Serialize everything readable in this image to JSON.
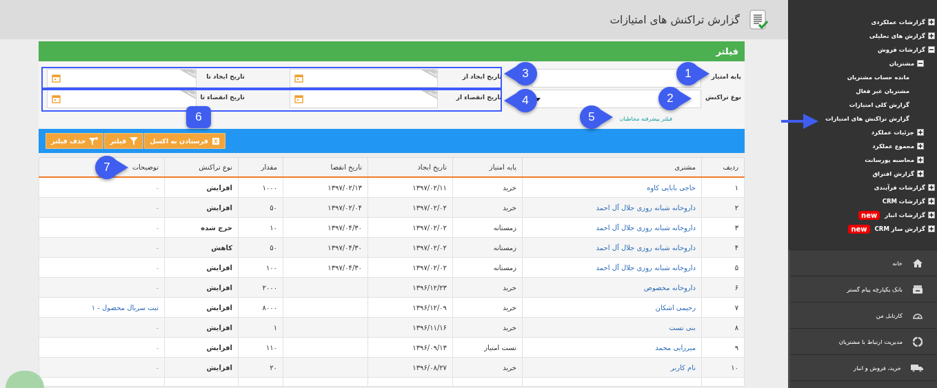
{
  "header": {
    "title": "گزارش تراکنش های امتیازات"
  },
  "filter": {
    "title": "فیلتر",
    "rows": [
      {
        "fields": [
          {
            "kind": "text",
            "label": "پایه امتیاز"
          },
          {
            "kind": "date",
            "label": "تاریخ ایجاد از"
          },
          {
            "kind": "date",
            "label": "تاریخ ایجاد تا"
          }
        ]
      },
      {
        "fields": [
          {
            "kind": "select",
            "label": "نوع تراکنش"
          },
          {
            "kind": "date",
            "label": "تاریخ انقضاء از"
          },
          {
            "kind": "date",
            "label": "تاریخ انقضاء تا"
          }
        ]
      }
    ],
    "advanced_link": "فیلتر پیشرفته مخاطبان",
    "toolbar": [
      {
        "label": "فرستادن به اکسل",
        "kind": "export"
      },
      {
        "label": "فیلتر",
        "kind": "filter"
      },
      {
        "label": "حذف فیلتر",
        "kind": "clear"
      }
    ]
  },
  "table": {
    "columns": [
      "ردیف",
      "مشتری",
      "پایه امتیاز",
      "تاریخ ایجاد",
      "تاریخ انقضا",
      "مقدار",
      "نوع تراکنش",
      "توضیحات"
    ],
    "rows": [
      {
        "index": "۱",
        "customer": "حاجی بابایی کاوه",
        "basis": "خرید",
        "created": "۱۳۹۷/۰۲/۱۱",
        "expires": "۱۳۹۷/۰۲/۱۳",
        "amount": "۱۰۰۰",
        "type": "افزایش",
        "note": "-",
        "note_is_link": false
      },
      {
        "index": "۲",
        "customer": "داروخانه شبانه روزی جلال آل احمد",
        "basis": "خرید",
        "created": "۱۳۹۷/۰۲/۰۲",
        "expires": "۱۳۹۷/۰۲/۰۴",
        "amount": "۵۰",
        "type": "افزایش",
        "note": "-",
        "note_is_link": false
      },
      {
        "index": "۳",
        "customer": "داروخانه شبانه روزی جلال آل احمد",
        "basis": "زمستانه",
        "created": "۱۳۹۷/۰۲/۰۲",
        "expires": "۱۳۹۷/۰۴/۳۰",
        "amount": "۱۰",
        "type": "خرج شده",
        "note": "-",
        "note_is_link": false
      },
      {
        "index": "۴",
        "customer": "داروخانه شبانه روزی جلال آل احمد",
        "basis": "زمستانه",
        "created": "۱۳۹۷/۰۲/۰۲",
        "expires": "۱۳۹۷/۰۴/۳۰",
        "amount": "۵۰",
        "type": "کاهش",
        "note": "-",
        "note_is_link": false
      },
      {
        "index": "۵",
        "customer": "داروخانه شبانه روزی جلال آل احمد",
        "basis": "زمستانه",
        "created": "۱۳۹۷/۰۲/۰۲",
        "expires": "۱۳۹۷/۰۴/۳۰",
        "amount": "۱۰۰",
        "type": "افزایش",
        "note": "-",
        "note_is_link": false
      },
      {
        "index": "۶",
        "customer": "داروخانه مخصوص",
        "basis": "خرید",
        "created": "۱۳۹۶/۱۲/۲۳",
        "amount": "۲۰۰۰",
        "type": "افزایش",
        "note": "-",
        "note_is_link": false
      },
      {
        "index": "۷",
        "customer": "رحیمی اشکان",
        "basis": "خرید",
        "created": "۱۳۹۶/۱۲/۰۹",
        "amount": "۸۰۰۰",
        "type": "افزایش",
        "note": "ثبت سریال محصول - ۱",
        "note_is_link": true
      },
      {
        "index": "۸",
        "customer": "بنی تست",
        "basis": "خرید",
        "created": "۱۳۹۶/۱۱/۱۶",
        "amount": "۱",
        "type": "افزایش",
        "note": "-",
        "note_is_link": false
      },
      {
        "index": "۹",
        "customer": "میرزایی محمد",
        "basis": "تست امتیاز",
        "created": "۱۳۹۶/۰۹/۱۳",
        "amount": "۱۱۰",
        "type": "افزایش",
        "note": "-",
        "note_is_link": false
      },
      {
        "index": "۱۰",
        "customer": "نام کاربر",
        "basis": "خرید",
        "created": "۱۳۹۶/۰۸/۲۷",
        "amount": "۲۰",
        "type": "افزایش",
        "note": "-",
        "note_is_link": false
      }
    ]
  },
  "sidebar": {
    "tree": [
      {
        "label": "گزارشات عملکردی",
        "expanded": false
      },
      {
        "label": "گزارش های تحلیلی",
        "expanded": false
      },
      {
        "label": "گزارشات فروش",
        "expanded": true,
        "children": [
          {
            "label": "مشتریان",
            "expanded": true,
            "children": [
              {
                "label": "مانده حساب مشتریان"
              },
              {
                "label": "مشتریان غیر فعال"
              },
              {
                "label": "گزارش کلی امتیازات"
              },
              {
                "label": "گزارش تراکنش های امتیازات"
              }
            ]
          },
          {
            "label": "جزئیات عملکرد",
            "expanded": false
          },
          {
            "label": "مجموع عملکرد",
            "expanded": false
          },
          {
            "label": "محاسبه پورسانت",
            "expanded": false
          },
          {
            "label": "گزارش افتراق",
            "expanded": false
          }
        ]
      },
      {
        "label": "گزارشات فرآیندی",
        "expanded": false
      },
      {
        "label": "گزارشات CRM",
        "expanded": false
      },
      {
        "label": "گزارشات انبار",
        "expanded": false,
        "badge": "new"
      },
      {
        "label": "گزارش ساز CRM",
        "expanded": false,
        "badge": "new"
      }
    ],
    "menu": [
      {
        "label": "خانه",
        "kind": "home"
      },
      {
        "label": "بانک یکپارچه پیام گستر",
        "kind": "bank"
      },
      {
        "label": "کارتابل من",
        "kind": "dashboard"
      },
      {
        "label": "مدیریت ارتباط با مشتریان",
        "kind": "crm"
      },
      {
        "label": "خرید، فروش و انبار",
        "kind": "logistics"
      }
    ]
  },
  "annotations": {
    "markers": [
      {
        "label": "1"
      },
      {
        "label": "2"
      },
      {
        "label": "3"
      },
      {
        "label": "4"
      },
      {
        "label": "5"
      },
      {
        "label": "6"
      },
      {
        "label": "7"
      }
    ]
  }
}
